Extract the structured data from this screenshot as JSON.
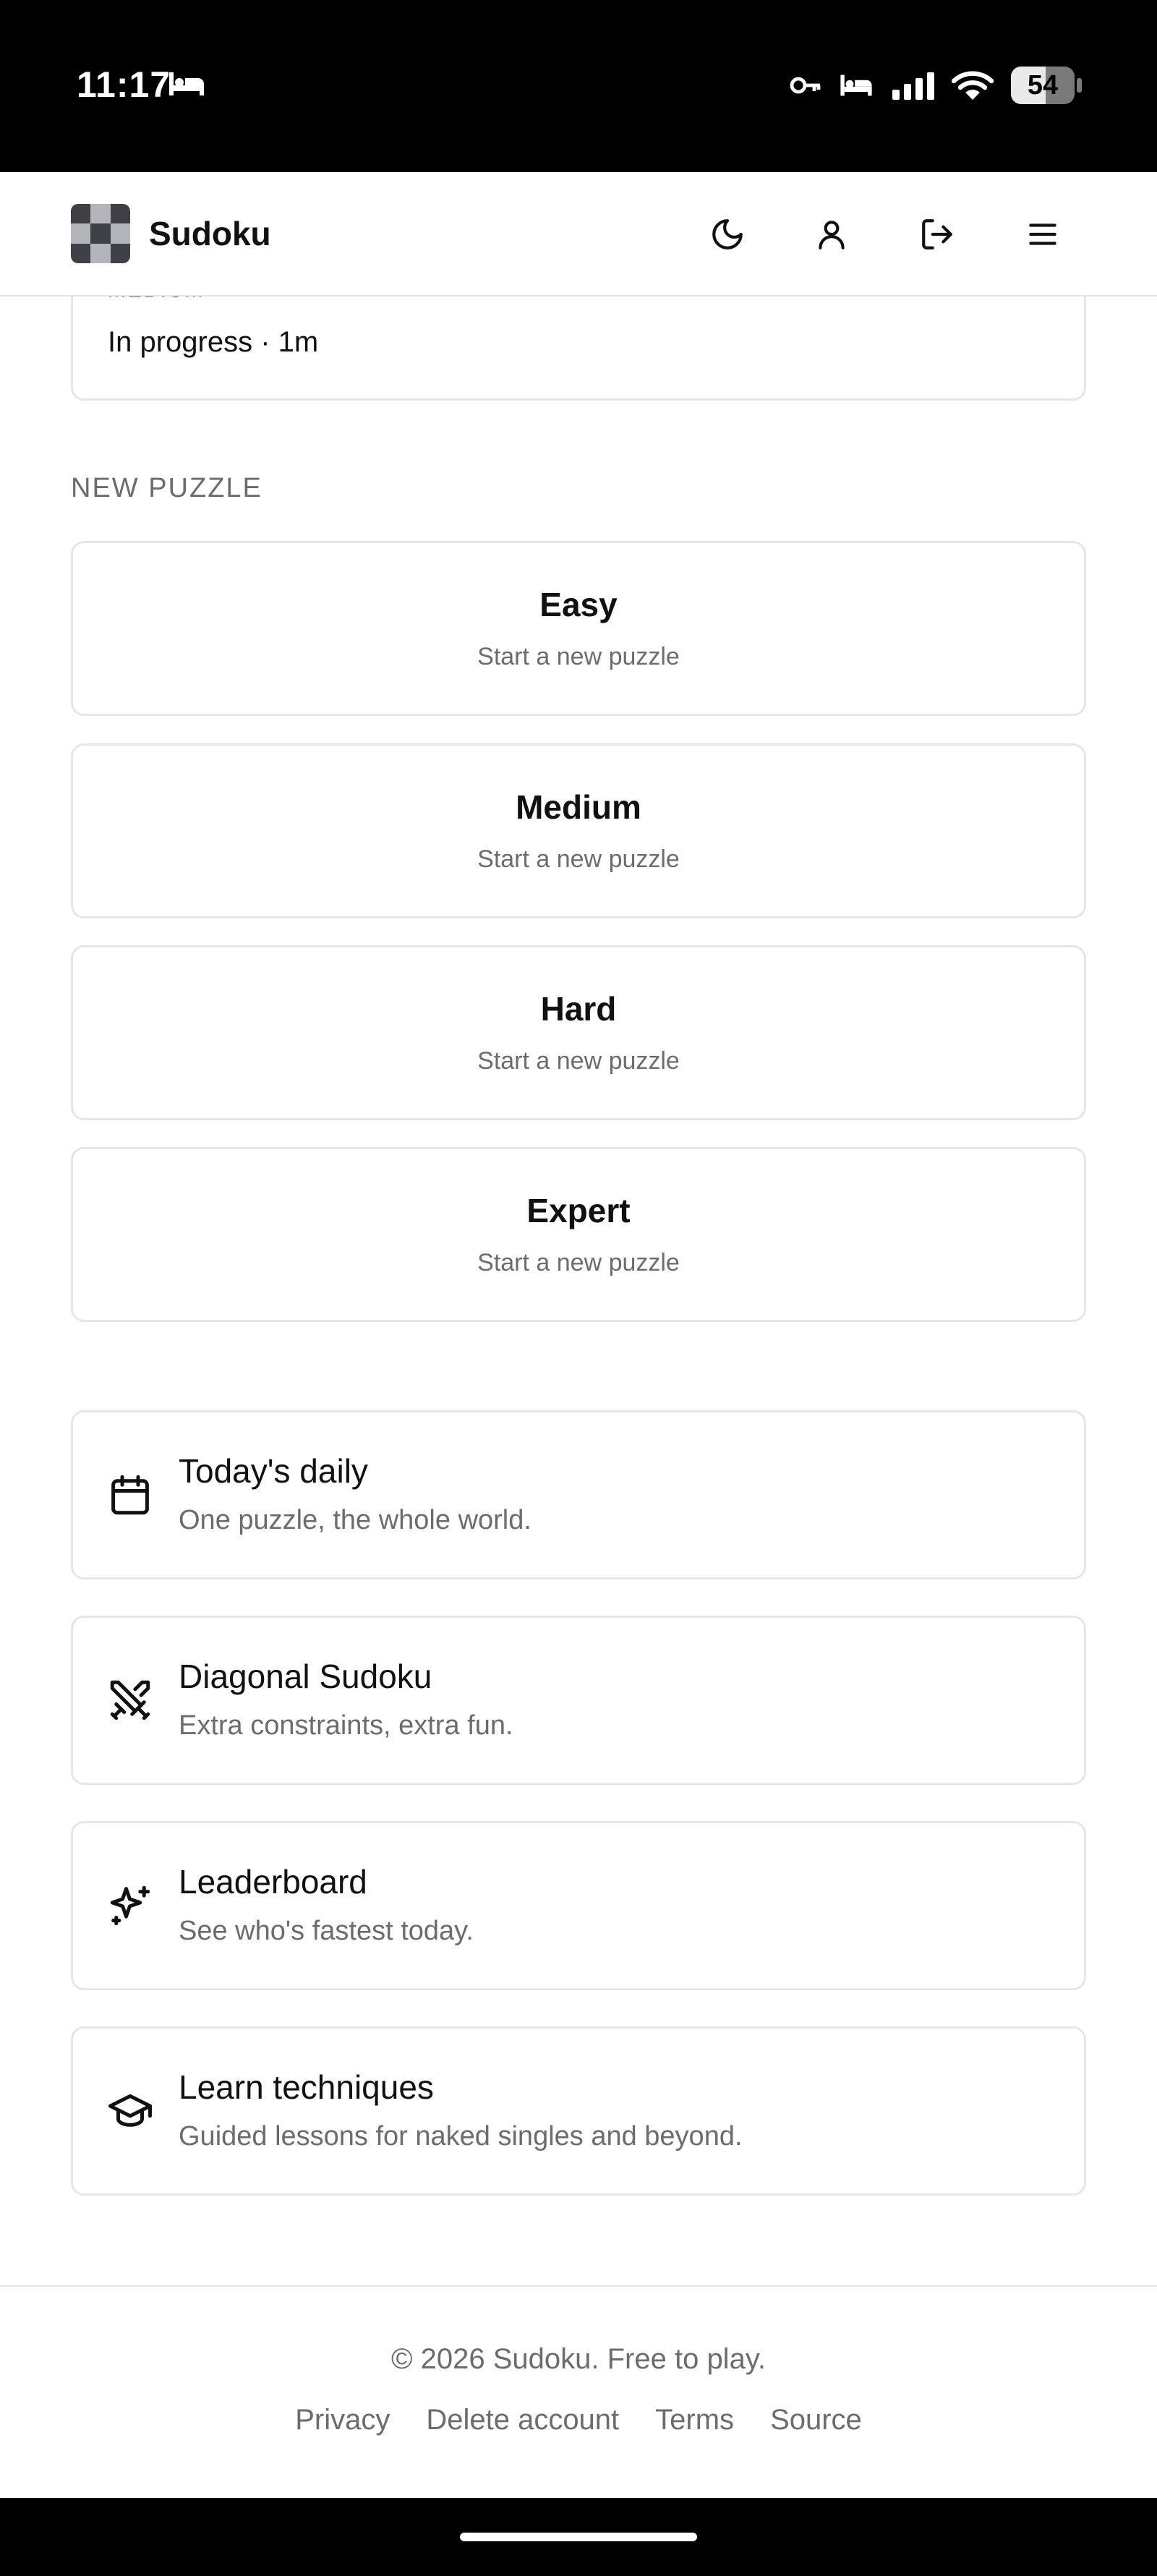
{
  "status_bar": {
    "time": "11:17",
    "battery_level": "54",
    "battery_fraction": 0.54,
    "icons": [
      "bed-icon",
      "key-icon",
      "bed-icon",
      "signal-icon",
      "wifi-icon",
      "battery-icon"
    ]
  },
  "header": {
    "title": "Sudoku",
    "actions": [
      "moon-icon",
      "user-icon",
      "logout-icon",
      "menu-icon"
    ]
  },
  "in_progress": {
    "difficulty": "MEDIUM",
    "status": "In progress · 1m"
  },
  "new_puzzle": {
    "heading": "NEW PUZZLE",
    "options": [
      {
        "title": "Easy",
        "subtitle": "Start a new puzzle"
      },
      {
        "title": "Medium",
        "subtitle": "Start a new puzzle"
      },
      {
        "title": "Hard",
        "subtitle": "Start a new puzzle"
      },
      {
        "title": "Expert",
        "subtitle": "Start a new puzzle"
      }
    ]
  },
  "features": [
    {
      "icon": "calendar-icon",
      "title": "Today's daily",
      "subtitle": "One puzzle, the whole world."
    },
    {
      "icon": "crossed-swords-icon",
      "title": "Diagonal Sudoku",
      "subtitle": "Extra constraints, extra fun."
    },
    {
      "icon": "sparkles-icon",
      "title": "Leaderboard",
      "subtitle": "See who's fastest today."
    },
    {
      "icon": "graduation-cap-icon",
      "title": "Learn techniques",
      "subtitle": "Guided lessons for naked singles and beyond."
    }
  ],
  "footer": {
    "copyright": "© 2026 Sudoku. Free to play.",
    "links": [
      "Privacy",
      "Delete account",
      "Terms",
      "Source"
    ]
  }
}
